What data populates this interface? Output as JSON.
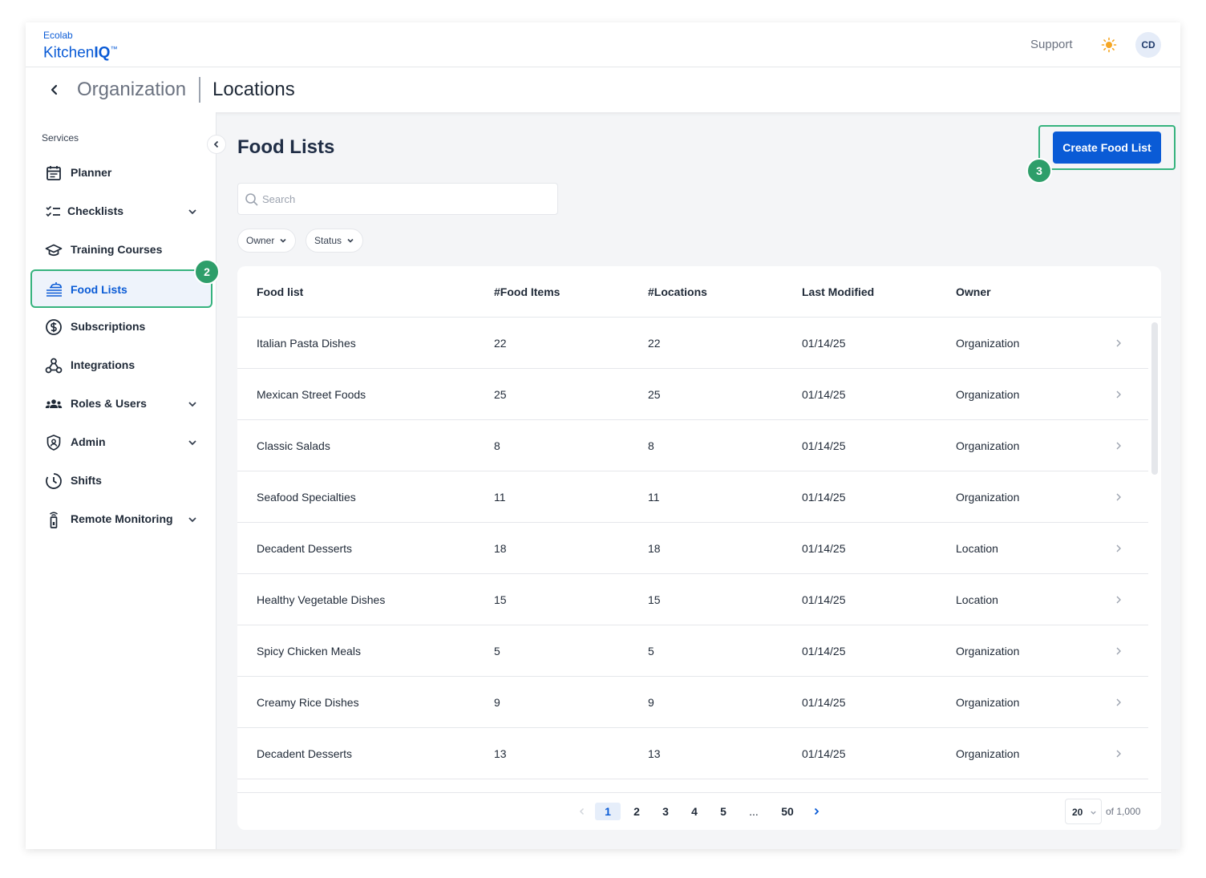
{
  "app": {
    "brand_top": "Ecolab",
    "brand_name_regular": "Kitchen",
    "brand_name_bold": "IQ",
    "brand_tm": "™"
  },
  "topbar": {
    "support_label": "Support",
    "theme_icon": "sun-icon",
    "avatar_initials": "CD"
  },
  "breadcrumb": {
    "back_icon": "chevron-left-icon",
    "parent": "Organization",
    "current": "Locations"
  },
  "sidebar": {
    "section_label": "Services",
    "items": [
      {
        "label": "Planner",
        "icon": "calendar-icon",
        "expandable": false,
        "active": false
      },
      {
        "label": "Checklists",
        "icon": "checklist-icon",
        "expandable": true,
        "active": false
      },
      {
        "label": "Training Courses",
        "icon": "graduation-cap-icon",
        "expandable": false,
        "active": false
      },
      {
        "label": "Food Lists",
        "icon": "food-tray-icon",
        "expandable": false,
        "active": true
      },
      {
        "label": "Subscriptions",
        "icon": "dollar-circle-icon",
        "expandable": false,
        "active": false
      },
      {
        "label": "Integrations",
        "icon": "webhook-icon",
        "expandable": false,
        "active": false
      },
      {
        "label": "Roles & Users",
        "icon": "users-icon",
        "expandable": true,
        "active": false
      },
      {
        "label": "Admin",
        "icon": "shield-user-icon",
        "expandable": true,
        "active": false
      },
      {
        "label": "Shifts",
        "icon": "clock-icon",
        "expandable": false,
        "active": false
      },
      {
        "label": "Remote Monitoring",
        "icon": "sensor-icon",
        "expandable": true,
        "active": false
      }
    ]
  },
  "steps": {
    "food_lists": "2",
    "create": "3"
  },
  "main": {
    "title": "Food Lists",
    "create_label": "Create Food List",
    "search_placeholder": "Search",
    "filters": [
      "Owner",
      "Status"
    ],
    "columns": [
      "Food list",
      "#Food Items",
      "#Locations",
      "Last Modified",
      "Owner"
    ],
    "rows": [
      [
        "Italian Pasta Dishes",
        "22",
        "22",
        "01/14/25",
        "Organization"
      ],
      [
        "Mexican Street Foods",
        "25",
        "25",
        "01/14/25",
        "Organization"
      ],
      [
        "Classic Salads",
        "8",
        "8",
        "01/14/25",
        "Organization"
      ],
      [
        "Seafood Specialties",
        "11",
        "11",
        "01/14/25",
        "Organization"
      ],
      [
        "Decadent Desserts",
        "18",
        "18",
        "01/14/25",
        "Location"
      ],
      [
        "Healthy Vegetable Dishes",
        "15",
        "15",
        "01/14/25",
        "Location"
      ],
      [
        "Spicy Chicken Meals",
        "5",
        "5",
        "01/14/25",
        "Organization"
      ],
      [
        "Creamy Rice Dishes",
        "9",
        "9",
        "01/14/25",
        "Organization"
      ],
      [
        "Decadent Desserts",
        "13",
        "13",
        "01/14/25",
        "Organization"
      ]
    ]
  },
  "pagination": {
    "pages": [
      "1",
      "2",
      "3",
      "4",
      "5",
      "...",
      "50"
    ],
    "current_page": "1",
    "page_size": "20",
    "total_label": "of 1,000"
  },
  "colors": {
    "primary": "#0a5bd6",
    "highlight": "#36b37e",
    "step_badge": "#2e9e6a",
    "sun": "#f5a623"
  }
}
